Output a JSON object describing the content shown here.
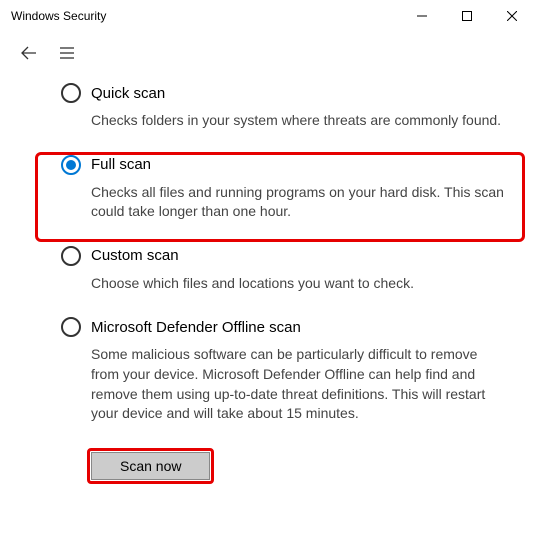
{
  "window": {
    "title": "Windows Security"
  },
  "options": {
    "quick": {
      "label": "Quick scan",
      "desc": "Checks folders in your system where threats are commonly found."
    },
    "full": {
      "label": "Full scan",
      "desc": "Checks all files and running programs on your hard disk. This scan could take longer than one hour."
    },
    "custom": {
      "label": "Custom scan",
      "desc": "Choose which files and locations you want to check."
    },
    "offline": {
      "label": "Microsoft Defender Offline scan",
      "desc": "Some malicious software can be particularly difficult to remove from your device. Microsoft Defender Offline can help find and remove them using up-to-date threat definitions. This will restart your device and will take about 15 minutes."
    }
  },
  "selected_option": "full",
  "action": {
    "scan_label": "Scan now"
  }
}
